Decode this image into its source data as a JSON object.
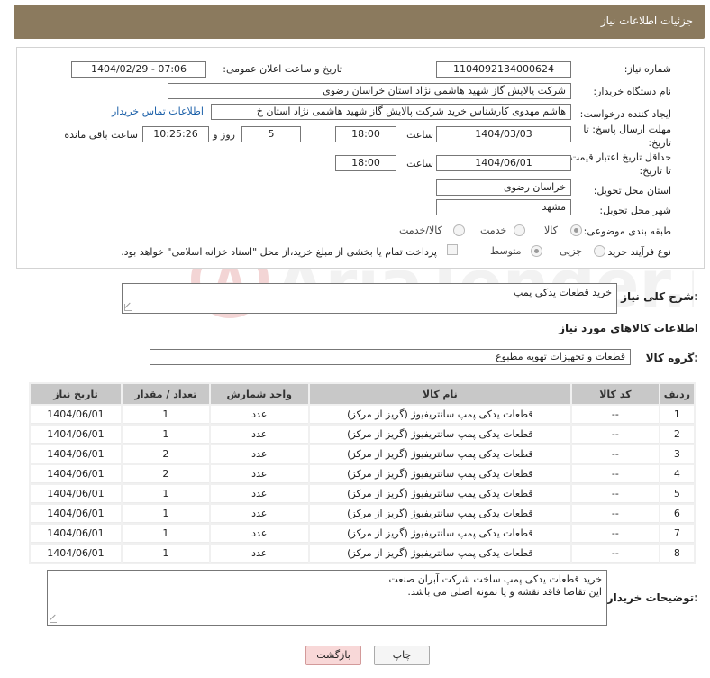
{
  "header": {
    "title": "جزئیات اطلاعات نیاز"
  },
  "form": {
    "need_number_label": "شماره نیاز:",
    "need_number": "1104092134000624",
    "announce_label": "تاریخ و ساعت اعلان عمومی:",
    "announce_value": "1404/02/29 - 07:06",
    "buyer_org_label": "نام دستگاه خریدار:",
    "buyer_org": "شرکت پالایش گاز شهید هاشمی نژاد   استان خراسان رضوی",
    "creator_label": "ایجاد کننده درخواست:",
    "creator": "هاشم مهدوی کارشناس خرید شرکت پالایش گاز شهید هاشمی نژاد   استان خ",
    "contact_link": "اطلاعات تماس خریدار",
    "reply_deadline_label_1": "مهلت ارسال پاسخ: تا",
    "reply_deadline_label_2": "تاریخ:",
    "reply_date": "1404/03/03",
    "time_label": "ساعت",
    "reply_time": "18:00",
    "days_value": "5",
    "days_label": "روز و",
    "remaining_time": "10:25:26",
    "remaining_label": "ساعت باقی مانده",
    "price_deadline_label_1": "حداقل تاریخ اعتبار قیمت:",
    "price_deadline_label_2": "تا تاریخ:",
    "price_date": "1404/06/01",
    "price_time_label": "ساعت",
    "price_time": "18:00",
    "delivery_province_label": "استان محل تحویل:",
    "delivery_province": "خراسان رضوی",
    "delivery_city_label": "شهر محل تحویل:",
    "delivery_city": "مشهد",
    "category_label": "طبقه بندی موضوعی:",
    "category_options": [
      "کالا",
      "خدمت",
      "کالا/خدمت"
    ],
    "process_label": "نوع فرآیند خرید :",
    "process_options": [
      "جزیی",
      "متوسط"
    ],
    "payment_note": "پرداخت تمام یا بخشی از مبلغ خرید،از محل \"اسناد خزانه اسلامی\" خواهد بود."
  },
  "description": {
    "label": "شرح کلی نیاز:",
    "value": "خرید قطعات یدکی پمپ"
  },
  "goods": {
    "section_title": "اطلاعات کالاهای مورد نیاز",
    "group_label": "گروه کالا:",
    "group_value": "قطعات و تجهیزات تهویه مطبوع"
  },
  "table": {
    "headers": [
      "ردیف",
      "کد کالا",
      "نام کالا",
      "واحد شمارش",
      "تعداد / مقدار",
      "تاریخ نیاز"
    ],
    "rows": [
      [
        "1",
        "--",
        "قطعات یدکی پمپ سانتریفیوژ (گریز از مرکز)",
        "عدد",
        "1",
        "1404/06/01"
      ],
      [
        "2",
        "--",
        "قطعات یدکی پمپ سانتریفیوژ (گریز از مرکز)",
        "عدد",
        "1",
        "1404/06/01"
      ],
      [
        "3",
        "--",
        "قطعات یدکی پمپ سانتریفیوژ (گریز از مرکز)",
        "عدد",
        "2",
        "1404/06/01"
      ],
      [
        "4",
        "--",
        "قطعات یدکی پمپ سانتریفیوژ (گریز از مرکز)",
        "عدد",
        "2",
        "1404/06/01"
      ],
      [
        "5",
        "--",
        "قطعات یدکی پمپ سانتریفیوژ (گریز از مرکز)",
        "عدد",
        "1",
        "1404/06/01"
      ],
      [
        "6",
        "--",
        "قطعات یدکی پمپ سانتریفیوژ (گریز از مرکز)",
        "عدد",
        "1",
        "1404/06/01"
      ],
      [
        "7",
        "--",
        "قطعات یدکی پمپ سانتریفیوژ (گریز از مرکز)",
        "عدد",
        "1",
        "1404/06/01"
      ],
      [
        "8",
        "--",
        "قطعات یدکی پمپ سانتریفیوژ (گریز از مرکز)",
        "عدد",
        "1",
        "1404/06/01"
      ]
    ]
  },
  "buyer_notes": {
    "label": "توضیحات خریدار:",
    "line1": "خرید قطعات یدکی پمپ ساخت شرکت آبران صنعت",
    "line2": "این تقاضا فاقد نقشه و یا نمونه اصلی می باشد."
  },
  "buttons": {
    "print": "چاپ",
    "back": "بازگشت"
  },
  "watermark": {
    "text": "AriaTender.neT"
  }
}
